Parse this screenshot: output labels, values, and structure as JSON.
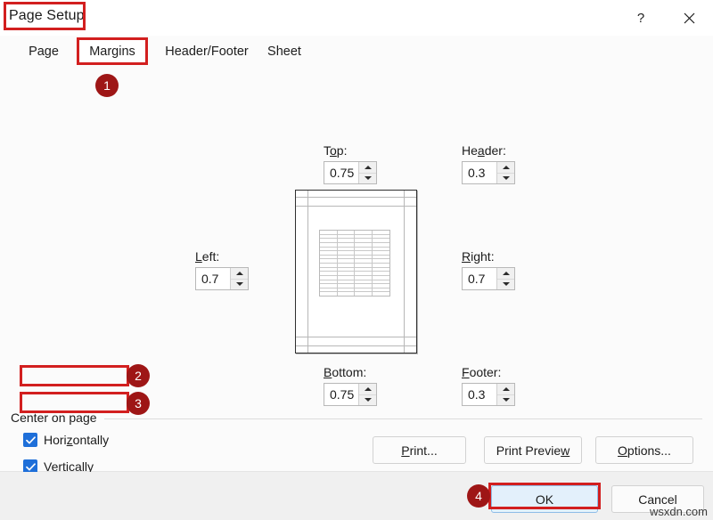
{
  "window": {
    "title": "Page Setup",
    "help_icon": "question-mark-icon",
    "close_icon": "close-x-icon"
  },
  "tabs": [
    {
      "label": "Page",
      "active": false
    },
    {
      "label": "Margins",
      "active": true
    },
    {
      "label": "Header/Footer",
      "active": false
    },
    {
      "label": "Sheet",
      "active": false
    }
  ],
  "margins": {
    "top": {
      "label_pre": "T",
      "label_accel": "o",
      "label_post": "p:",
      "label_full": "Top:",
      "value": "0.75"
    },
    "header": {
      "label_pre": "He",
      "label_accel": "a",
      "label_post": "der:",
      "label_full": "Header:",
      "value": "0.3"
    },
    "left": {
      "label_pre": "",
      "label_accel": "L",
      "label_post": "eft:",
      "label_full": "Left:",
      "value": "0.7"
    },
    "right": {
      "label_pre": "",
      "label_accel": "R",
      "label_post": "ight:",
      "label_full": "Right:",
      "value": "0.7"
    },
    "bottom": {
      "label_pre": "",
      "label_accel": "B",
      "label_post": "ottom:",
      "label_full": "Bottom:",
      "value": "0.75"
    },
    "footer": {
      "label_pre": "",
      "label_accel": "F",
      "label_post": "ooter:",
      "label_full": "Footer:",
      "value": "0.3"
    }
  },
  "preview": {
    "name": "page-margins-preview",
    "grid_rows": 16,
    "grid_cols": 4
  },
  "center_on_page": {
    "legend": "Center on page",
    "horizontally": {
      "label_pre": "Hori",
      "label_accel": "z",
      "label_post": "ontally",
      "label_full": "Horizontally",
      "checked": true
    },
    "vertically": {
      "label_pre": "",
      "label_accel": "V",
      "label_post": "ertically",
      "label_full": "Vertically",
      "checked": true
    }
  },
  "action_buttons": {
    "print": {
      "pre": "",
      "accel": "P",
      "post": "rint...",
      "full": "Print..."
    },
    "print_preview": {
      "pre": "Print Previe",
      "accel": "w",
      "post": "",
      "full": "Print Preview"
    },
    "options": {
      "pre": "",
      "accel": "O",
      "post": "ptions...",
      "full": "Options..."
    }
  },
  "dialog_buttons": {
    "ok": {
      "label": "OK",
      "default": true
    },
    "cancel": {
      "label": "Cancel",
      "default": false
    }
  },
  "annotations": {
    "badges": [
      {
        "number": "1",
        "target": "margins-tab"
      },
      {
        "number": "2",
        "target": "horizontally-checkbox"
      },
      {
        "number": "3",
        "target": "vertically-checkbox"
      },
      {
        "number": "4",
        "target": "ok-button"
      }
    ],
    "highlight_color": "#d21f1f",
    "badge_color": "#9e1616"
  },
  "watermark": {
    "text": "wsxdn.com"
  }
}
